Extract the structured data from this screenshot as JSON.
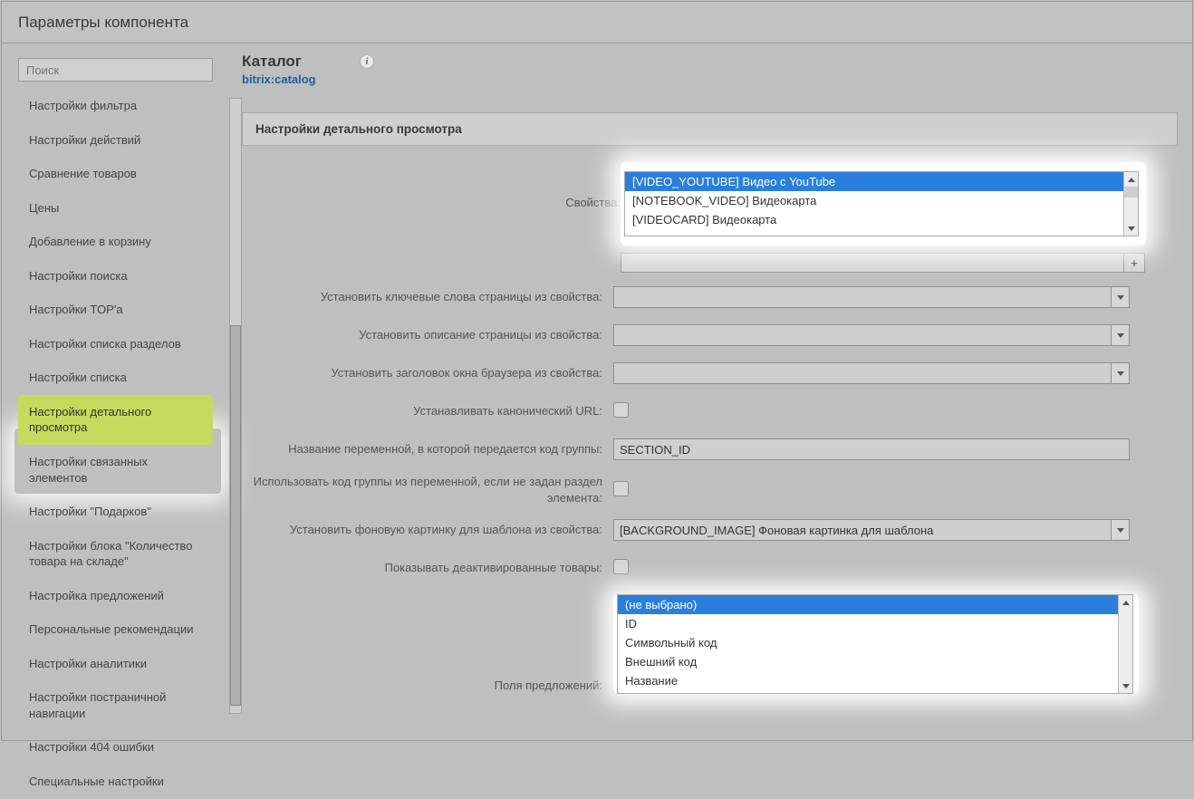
{
  "title_bar": "Параметры компонента",
  "sidebar": {
    "search_placeholder": "Поиск",
    "items": [
      "Настройки фильтра",
      "Настройки действий",
      "Сравнение товаров",
      "Цены",
      "Добавление в корзину",
      "Настройки поиска",
      "Настройки TOP'а",
      "Настройки списка разделов",
      "Настройки списка",
      "Настройки детального просмотра",
      "Настройки связанных элементов",
      "Настройки \"Подарков\"",
      "Настройки блока \"Количество товара на складе\"",
      "Настройка предложений",
      "Персональные рекомендации",
      "Настройки аналитики",
      "Настройки постраничной навигации",
      "Настройки 404 ошибки",
      "Специальные настройки"
    ],
    "active_index": 9
  },
  "component": {
    "title": "Каталог",
    "code": "bitrix:catalog"
  },
  "section_header": "Настройки детального просмотра",
  "labels": {
    "properties": "Свойства:",
    "meta_keywords": "Установить ключевые слова страницы из свойства:",
    "meta_description": "Установить описание страницы из свойства:",
    "browser_title": "Установить заголовок окна браузера из свойства:",
    "canonical": "Устанавливать канонический URL:",
    "section_var": "Название переменной, в которой передается код группы:",
    "use_code": "Использовать код группы из переменной, если не задан раздел элемента:",
    "bg_image": "Установить фоновую картинку для шаблона из свойства:",
    "deactivated": "Показывать деактивированные товары:",
    "offer_fields": "Поля предложений:"
  },
  "properties_list": {
    "options": [
      "[VIDEO_YOUTUBE] Видео с YouTube",
      "[NOTEBOOK_VIDEO] Видеокарта",
      "[VIDEOCARD] Видеокарта"
    ],
    "selected_index": 0
  },
  "values": {
    "section_var": "SECTION_ID",
    "bg_image": "[BACKGROUND_IMAGE] Фоновая картинка для шаблона"
  },
  "offer_fields_list": {
    "options": [
      "(не выбрано)",
      "ID",
      "Символьный код",
      "Внешний код",
      "Название"
    ],
    "selected_index": 0
  },
  "plus_label": "+"
}
